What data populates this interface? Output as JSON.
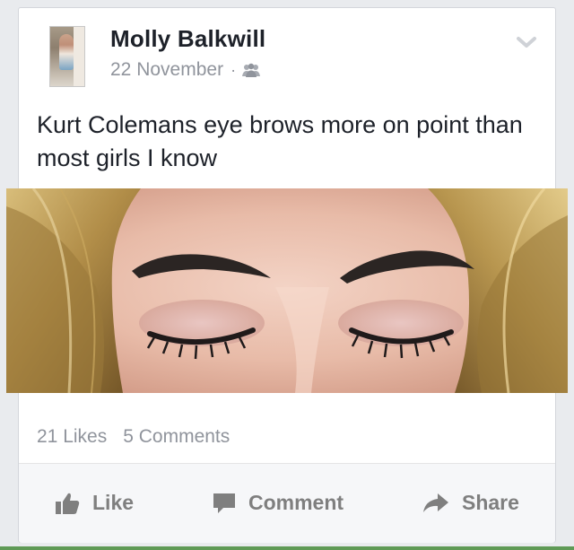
{
  "post": {
    "author": "Molly Balkwill",
    "date": "22 November",
    "separator": "·",
    "audience_icon": "friends-icon",
    "text": "Kurt Colemans eye brows more on point than most girls I know",
    "image_description_icon": "photo"
  },
  "stats": {
    "likes": "21 Likes",
    "comments": "5 Comments"
  },
  "actions": {
    "like": "Like",
    "comment": "Comment",
    "share": "Share"
  },
  "colors": {
    "name": "#1d2129",
    "meta": "#90949c",
    "action": "#7f7f7f",
    "background": "#e9ebee"
  }
}
